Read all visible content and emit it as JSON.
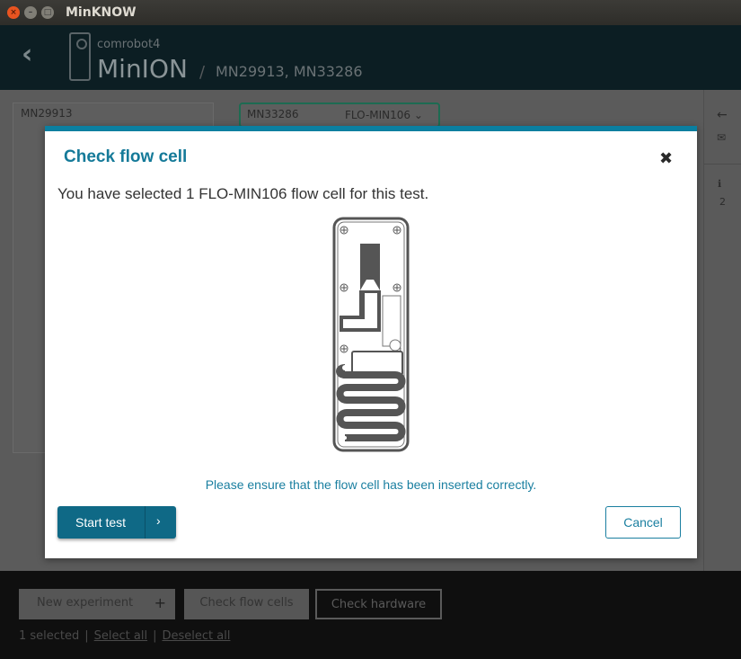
{
  "window": {
    "title": "MinKNOW",
    "controls": {
      "close": "×",
      "minimize": "–",
      "maximize": "□"
    }
  },
  "header": {
    "host": "comrobot4",
    "device": "MinION",
    "separator": "/",
    "flow_cells": "MN29913, MN33286"
  },
  "panels": {
    "left": {
      "label": "MN29913"
    },
    "right": {
      "label": "MN33286",
      "flow_cell_type": "FLO-MIN106"
    }
  },
  "sidebar": {
    "badge_count": "2"
  },
  "bottom": {
    "new_experiment": "New experiment",
    "new_experiment_plus": "+",
    "check_flow_cells": "Check flow cells",
    "check_hardware": "Check hardware",
    "selected": "1 selected",
    "divider": "|",
    "select_all": "Select all",
    "deselect_all": "Deselect all"
  },
  "modal": {
    "title": "Check flow cell",
    "close": "✖",
    "description": "You have selected 1 FLO-MIN106 flow cell for this test.",
    "note": "Please ensure that the flow cell has been inserted correctly.",
    "start_button": "Start test",
    "start_chevron": "›",
    "cancel_button": "Cancel"
  },
  "colors": {
    "accent": "#0a7fa0",
    "primary_button": "#0f6986",
    "title": "#157a99"
  }
}
